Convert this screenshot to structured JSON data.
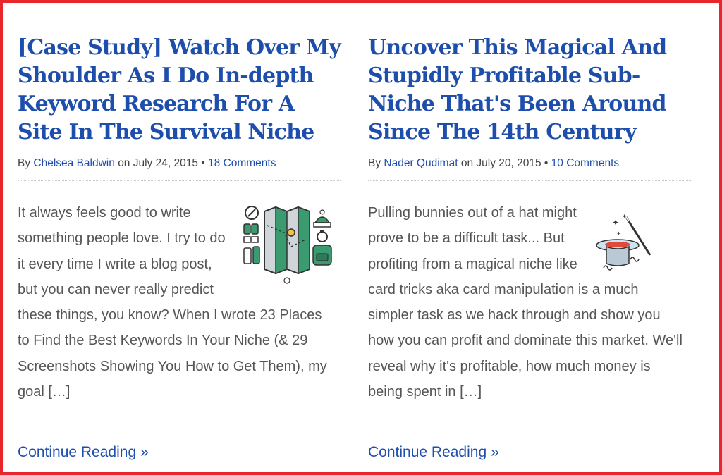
{
  "posts": [
    {
      "title": "[Case Study] Watch Over My Shoulder As I Do In-depth Keyword Research For A Site In The Survival Niche",
      "by_label": "By",
      "author": "Chelsea Baldwin",
      "date_text": "on July 24, 2015 •",
      "comments": "18 Comments",
      "excerpt": "It always feels good to write something people love. I try to do it every time I write a blog post, but you can never really predict these things, you know? When I wrote 23 Places to Find the Best Keywords In Your Niche (& 29 Screenshots Showing You How to Get Them), my goal […]",
      "read_more": "Continue Reading »",
      "thumbnail_icon": "survival-map-gear-icon"
    },
    {
      "title": "Uncover This Magical And Stupidly Profitable Sub-Niche That's Been Around Since The 14th Century",
      "by_label": "By",
      "author": "Nader Qudimat",
      "date_text": "on July 20, 2015 •",
      "comments": "10 Comments",
      "excerpt": "Pulling bunnies out of a hat might prove to be a difficult task... But profiting from a magical niche like card tricks aka card manipulation is a much simpler task as we hack through and show you how you can profit and dominate this market. We'll reveal why it's profitable, how much money is being spent in […]",
      "read_more": "Continue Reading »",
      "thumbnail_icon": "magic-hat-wand-icon"
    }
  ],
  "colors": {
    "link": "#1e4eab",
    "frame_border": "#e8262c",
    "body_text": "#555555"
  }
}
